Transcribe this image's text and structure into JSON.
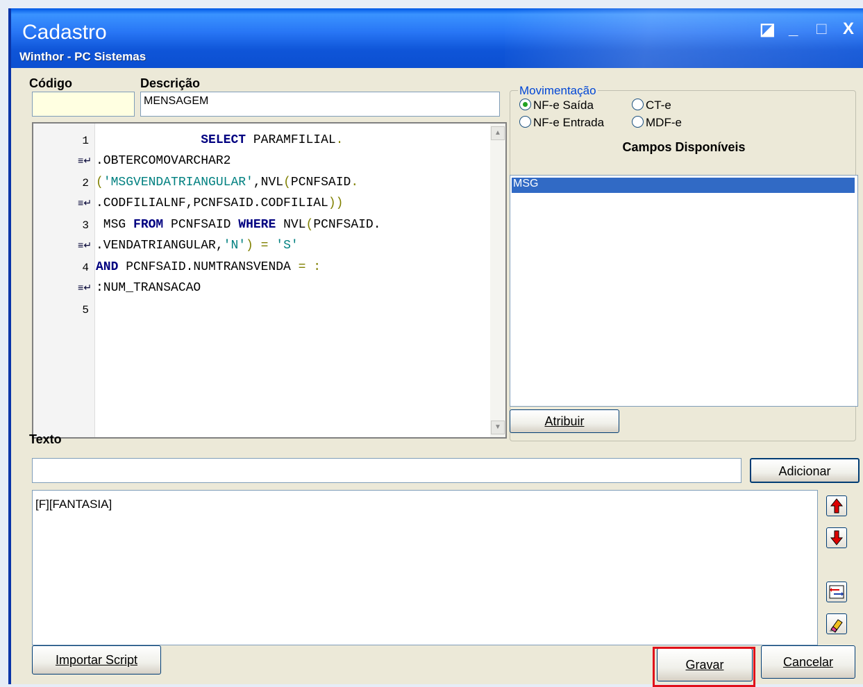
{
  "window": {
    "title": "Cadastro",
    "subtitle": "Winthor - PC Sistemas",
    "controls": {
      "restore": "◪",
      "minimize": "_",
      "maximize": "□",
      "close": "X"
    }
  },
  "form": {
    "codigo_label": "Código",
    "codigo_value": "",
    "descricao_label": "Descrição",
    "descricao_value": "MENSAGEM"
  },
  "editor": {
    "lines": [
      {
        "ln": "1",
        "wrap": false,
        "segments": [
          {
            "t": "              ",
            "c": "plain"
          },
          {
            "t": "SELECT",
            "c": "kw"
          },
          {
            "t": " PARAMFILIAL",
            "c": "plain"
          },
          {
            "t": ".",
            "c": "pn"
          }
        ]
      },
      {
        "ln": "",
        "wrap": true,
        "segments": [
          {
            "t": ".OBTERCOMOVARCHAR2",
            "c": "plain"
          }
        ]
      },
      {
        "ln": "2",
        "wrap": false,
        "segments": [
          {
            "t": "(",
            "c": "pn"
          },
          {
            "t": "'MSGVENDATRIANGULAR'",
            "c": "str"
          },
          {
            "t": ",NVL",
            "c": "plain"
          },
          {
            "t": "(",
            "c": "pn"
          },
          {
            "t": "PCNFSAID",
            "c": "plain"
          },
          {
            "t": ".",
            "c": "pn"
          }
        ]
      },
      {
        "ln": "",
        "wrap": true,
        "segments": [
          {
            "t": ".CODFILIALNF,PCNFSAID.CODFILIAL",
            "c": "plain"
          },
          {
            "t": "))",
            "c": "pn"
          }
        ]
      },
      {
        "ln": "3",
        "wrap": false,
        "segments": [
          {
            "t": " MSG ",
            "c": "plain"
          },
          {
            "t": "FROM",
            "c": "kw"
          },
          {
            "t": " PCNFSAID ",
            "c": "plain"
          },
          {
            "t": "WHERE",
            "c": "kw"
          },
          {
            "t": " NVL",
            "c": "plain"
          },
          {
            "t": "(",
            "c": "pn"
          },
          {
            "t": "PCNFSAID.",
            "c": "plain"
          }
        ]
      },
      {
        "ln": "",
        "wrap": true,
        "segments": [
          {
            "t": ".VENDATRIANGULAR,",
            "c": "plain"
          },
          {
            "t": "'N'",
            "c": "str"
          },
          {
            "t": ") = ",
            "c": "pn"
          },
          {
            "t": "'S'",
            "c": "str"
          }
        ]
      },
      {
        "ln": "4",
        "wrap": false,
        "segments": [
          {
            "t": "AND",
            "c": "kw"
          },
          {
            "t": " PCNFSAID.NUMTRANSVENDA ",
            "c": "plain"
          },
          {
            "t": "= :",
            "c": "pn"
          }
        ]
      },
      {
        "ln": "",
        "wrap": true,
        "segments": [
          {
            "t": ":NUM_TRANSACAO",
            "c": "plain"
          }
        ]
      },
      {
        "ln": "5",
        "wrap": false,
        "segments": []
      }
    ]
  },
  "movimentacao": {
    "legend": "Movimentação",
    "options": [
      {
        "label": "NF-e Saída",
        "checked": true
      },
      {
        "label": "CT-e",
        "checked": false
      },
      {
        "label": "NF-e Entrada",
        "checked": false
      },
      {
        "label": "MDF-e",
        "checked": false
      }
    ],
    "campos_label": "Campos Disponíveis",
    "campos": [
      "MSG"
    ],
    "atribuir": "Atribuir"
  },
  "texto": {
    "label": "Texto",
    "value": "",
    "adicionar": "Adicionar",
    "content": "[F][FANTASIA]"
  },
  "side_icons": [
    "arrow-up-icon",
    "arrow-down-icon",
    "swap-icon",
    "eraser-icon"
  ],
  "footer": {
    "importar": "Importar Script",
    "gravar": "Gravar",
    "cancelar": "Cancelar"
  },
  "colors": {
    "accent": "#0054e3",
    "highlight_border": "#e0101a",
    "selection": "#316ac5"
  }
}
